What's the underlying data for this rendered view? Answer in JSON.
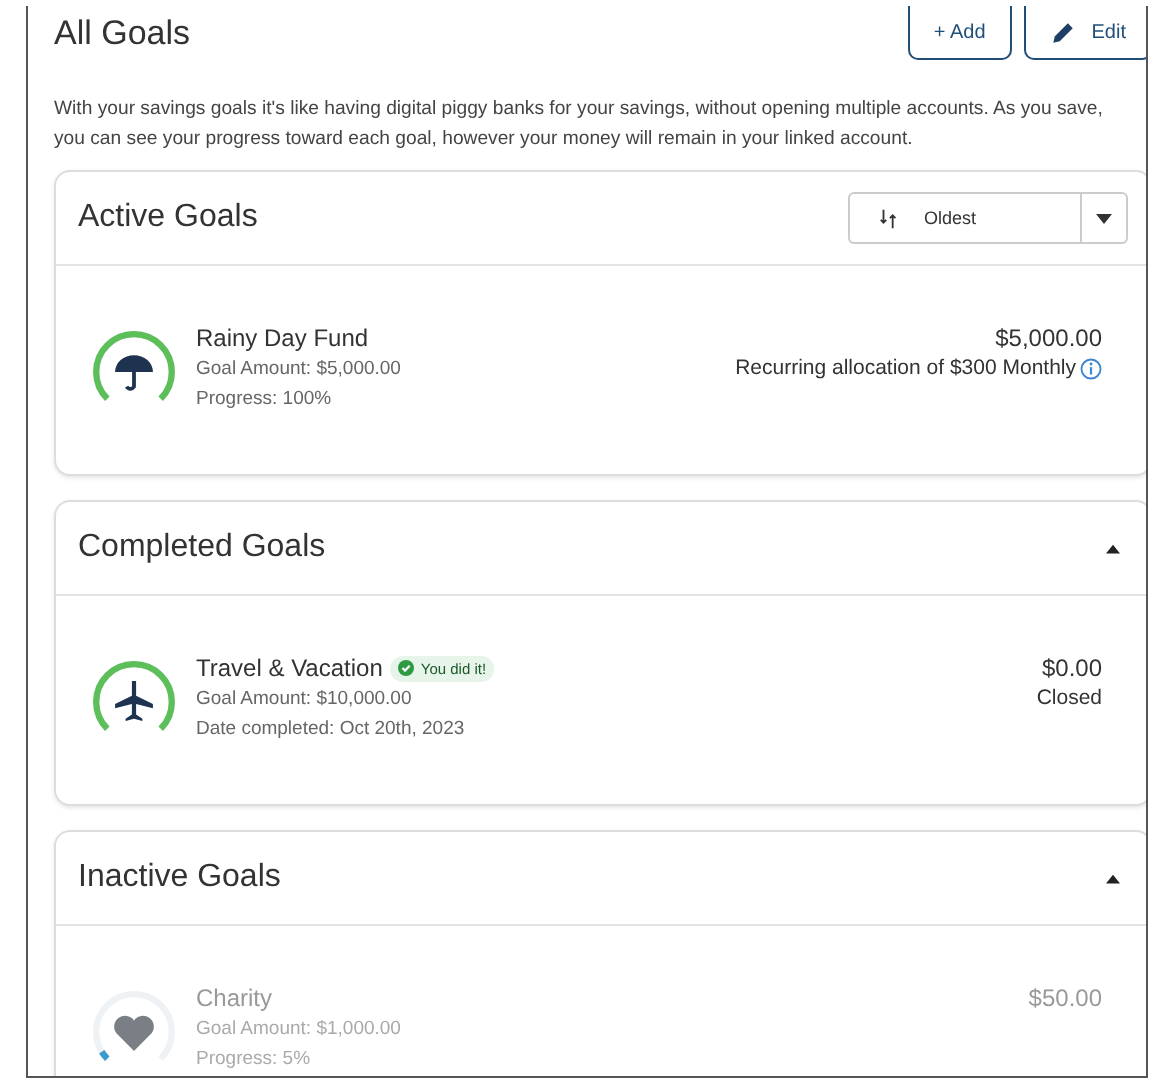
{
  "page": {
    "title": "All Goals",
    "buttons": [
      {
        "kind": "add",
        "label": "+ Add"
      },
      {
        "kind": "edit",
        "label": "Edit"
      }
    ],
    "description": "With your savings goals it's like having digital piggy banks for your savings, without opening multiple accounts. As you save, you can see your progress toward each goal, however your money will remain in your linked account."
  },
  "sections": [
    {
      "title": "Active Goals",
      "kind": "active",
      "sort": {
        "label": "Oldest"
      },
      "goals": [
        {
          "name": "Rainy Day Fund",
          "level": 1,
          "details": [
            "Goal Amount: $5,000.00",
            "Progress: 100%"
          ],
          "amount": "$5,000.00",
          "note": "Recurring allocation of $300 Monthly",
          "info": true
        }
      ]
    },
    {
      "title": "Completed Goals",
      "kind": "completed",
      "expanded": true,
      "goals": [
        {
          "name": "Travel & Vacation",
          "badge": "You did it!",
          "level": 1,
          "details": [
            "Goal Amount: $10,000.00",
            "Date completed: Oct 20th, 2023"
          ],
          "amount": "$0.00",
          "note": "Closed",
          "info": false
        }
      ]
    },
    {
      "title": "Inactive Goals",
      "kind": "inactive",
      "expanded": true,
      "goals": [
        {
          "name": "Charity",
          "level": 0.05,
          "details": [
            "Goal Amount: $1,000.00",
            "Progress: 5%"
          ],
          "amount": "$50.00",
          "info": false
        }
      ]
    }
  ]
}
